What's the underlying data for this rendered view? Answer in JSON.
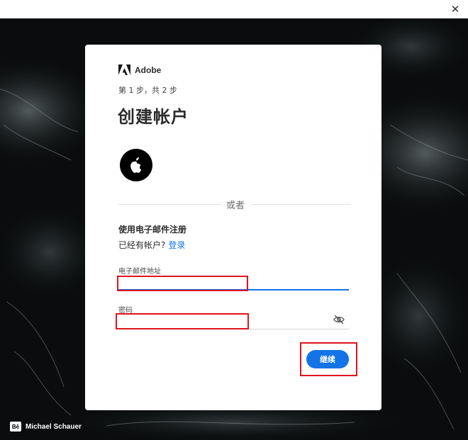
{
  "window": {
    "close_glyph": "✕"
  },
  "card": {
    "brand": "Adobe",
    "step": "第 1 步，共 2 步",
    "title": "创建帐户",
    "social": {
      "icon": "apple-icon"
    },
    "divider_text": "或者",
    "email_heading": "使用电子邮件注册",
    "have_account": "已经有帐户?",
    "signin_link": "登录",
    "email": {
      "label": "电子邮件地址",
      "value": ""
    },
    "password": {
      "label": "密码",
      "value": "",
      "toggle_icon": "eye-slash-icon"
    },
    "continue_label": "继续"
  },
  "background": {
    "credit_badge": "Bē",
    "credit": "Michael Schauer"
  },
  "colors": {
    "accent": "#1473e6",
    "highlight": "#e0141e",
    "background": "#0a0c0d"
  }
}
